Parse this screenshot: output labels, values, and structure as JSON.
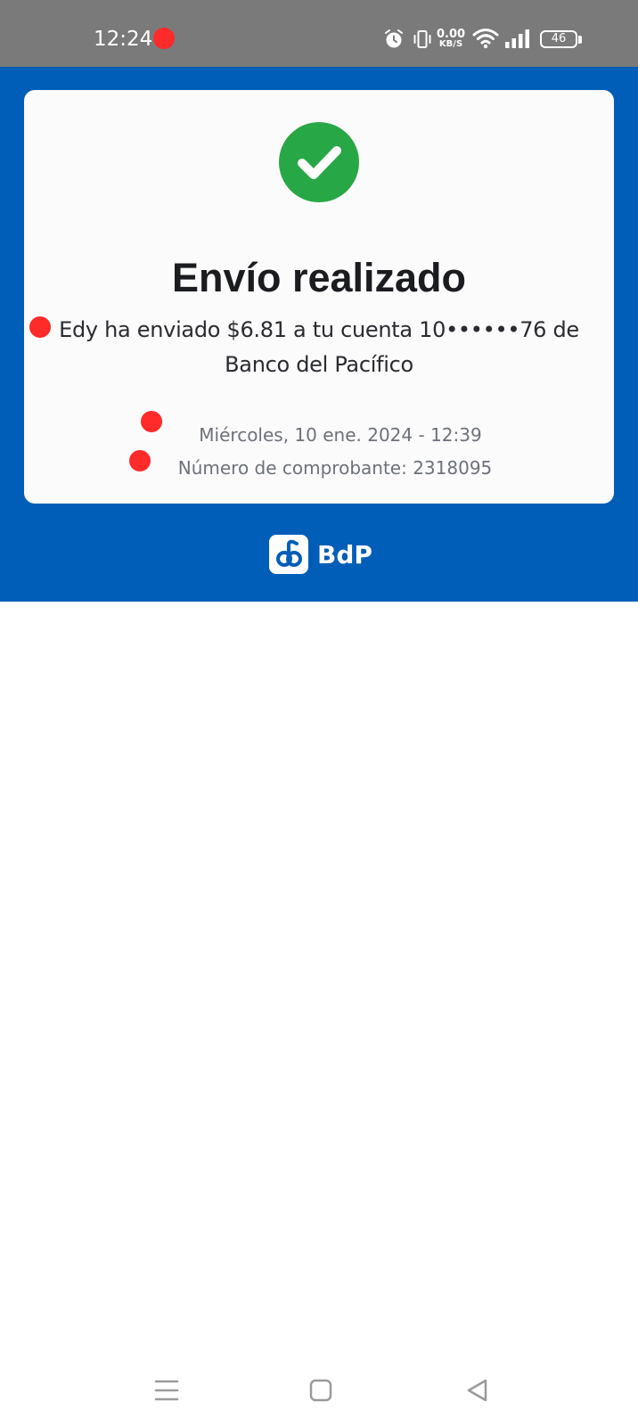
{
  "status_bar": {
    "time": "12:24",
    "net_speed_value": "0.00",
    "net_speed_unit": "KB/S",
    "battery_level": "46",
    "icons": [
      "alarm-icon",
      "vibrate-icon",
      "wifi-icon",
      "signal-icon",
      "battery-icon"
    ]
  },
  "receipt": {
    "title": "Envío realizado",
    "message": "Edy ha enviado $6.81 a tu cuenta 10••••••76 de Banco del Pacífico",
    "date": "Miércoles, 10 ene. 2024 - 12:39",
    "receipt_number": "Número de comprobante: 2318095"
  },
  "brand": {
    "name": "BdP"
  },
  "colors": {
    "brand_blue": "#005eb8",
    "success_green": "#28a746",
    "status_bar": "#7a7a7a",
    "marker_red": "#ff2a2a"
  },
  "nav_bar": {
    "icons": [
      "menu-icon",
      "home-icon",
      "back-icon"
    ]
  }
}
